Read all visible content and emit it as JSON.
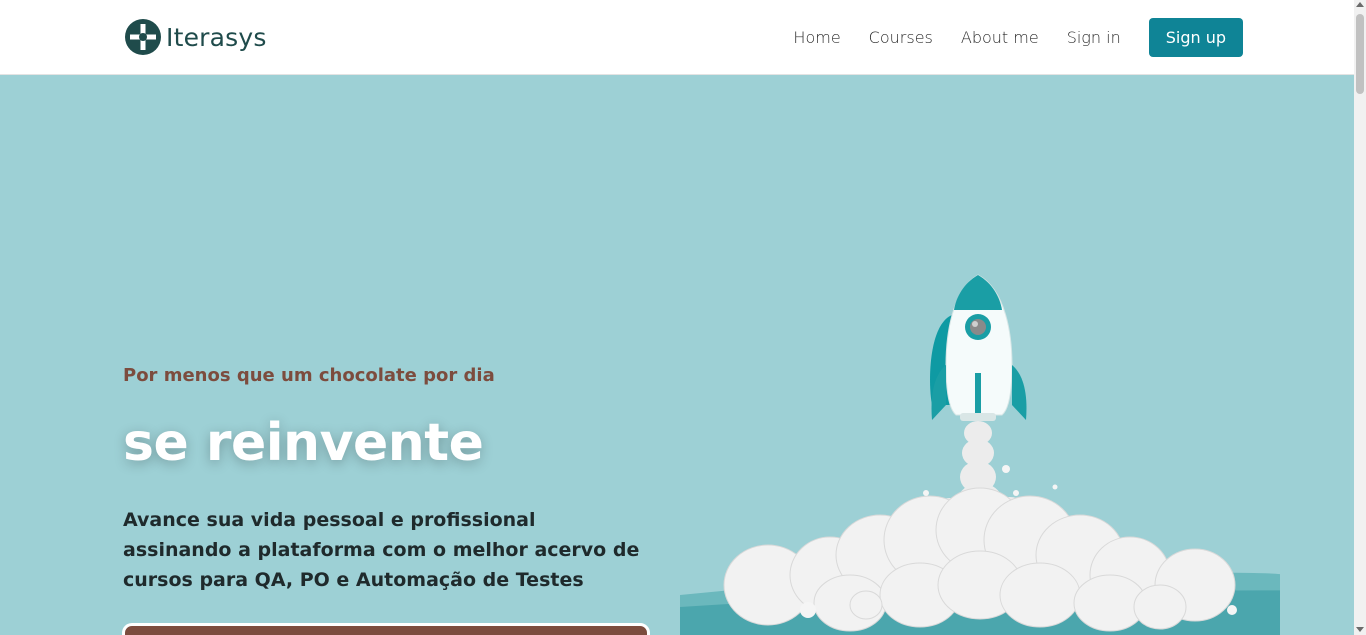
{
  "header": {
    "brand": "Iterasys",
    "nav": {
      "home": "Home",
      "courses": "Courses",
      "about": "About me",
      "signin": "Sign in",
      "signup": "Sign up"
    }
  },
  "hero": {
    "eyebrow": "Por menos que um chocolate por dia",
    "headline": "se reinvente",
    "description": "Avance sua vida pessoal e profissional assinando a plataforma com o melhor acervo de cursos para QA, PO e Automação de Testes"
  },
  "icons": {
    "logo": "plus-circle-logo-icon",
    "illustration": "rocket-launch-illustration"
  },
  "colors": {
    "brand": "#1f4b4b",
    "accent": "#0f8496",
    "hero_bg": "#9dd0d5",
    "eyebrow": "#7c4c3e"
  }
}
